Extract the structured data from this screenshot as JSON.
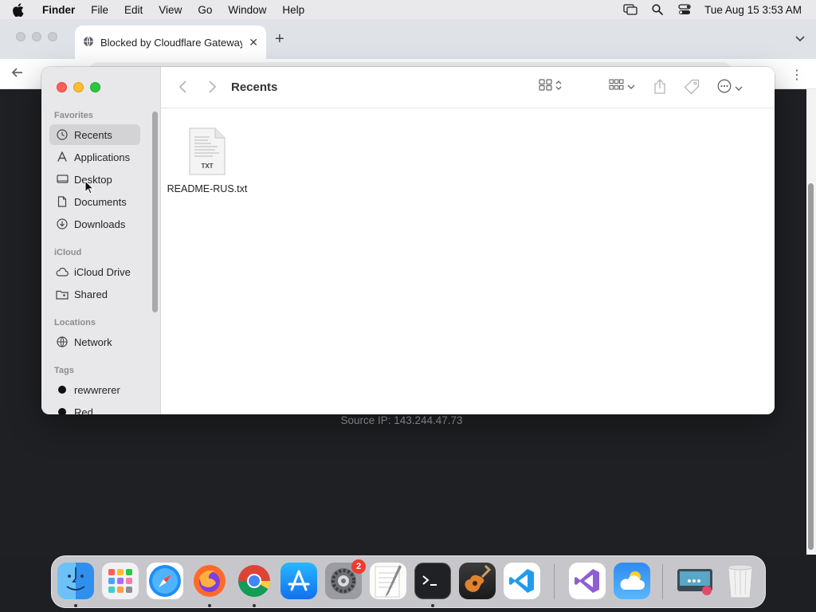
{
  "menubar": {
    "app_name": "Finder",
    "items": [
      "File",
      "Edit",
      "View",
      "Go",
      "Window",
      "Help"
    ],
    "clock": "Tue Aug 15  3:53 AM",
    "status_icons": [
      "screen-mirroring-icon",
      "spotlight-search-icon",
      "control-center-icon"
    ]
  },
  "browser": {
    "tab_title": "Blocked by Cloudflare Gateway",
    "page": {
      "source_ip": "Source IP: 143.244.47.73"
    }
  },
  "finder": {
    "title": "Recents",
    "sidebar": {
      "favorites_label": "Favorites",
      "favorites": [
        {
          "label": "Recents",
          "icon": "clock-icon",
          "selected": true
        },
        {
          "label": "Applications",
          "icon": "applications-icon"
        },
        {
          "label": "Desktop",
          "icon": "desktop-icon"
        },
        {
          "label": "Documents",
          "icon": "document-icon"
        },
        {
          "label": "Downloads",
          "icon": "download-icon"
        }
      ],
      "icloud_label": "iCloud",
      "icloud": [
        {
          "label": "iCloud Drive",
          "icon": "cloud-icon"
        },
        {
          "label": "Shared",
          "icon": "shared-folder-icon"
        }
      ],
      "locations_label": "Locations",
      "locations": [
        {
          "label": "Network",
          "icon": "globe-icon"
        }
      ],
      "tags_label": "Tags",
      "tags": [
        {
          "label": "rewwrerer",
          "color": "#111111"
        },
        {
          "label": "Red",
          "color": "#111111"
        }
      ]
    },
    "files": [
      {
        "name": "README-RUS.txt",
        "type_label": "TXT"
      }
    ]
  },
  "dock": {
    "apps": [
      "Finder",
      "Launchpad",
      "Safari",
      "Firefox",
      "Google Chrome",
      "App Store",
      "System Settings",
      "TextEdit",
      "Terminal",
      "GarageBand",
      "Visual Studio Code",
      "Visual Studio",
      "Weather",
      "Screen Sharing",
      "Trash"
    ],
    "settings_badge": "2"
  }
}
